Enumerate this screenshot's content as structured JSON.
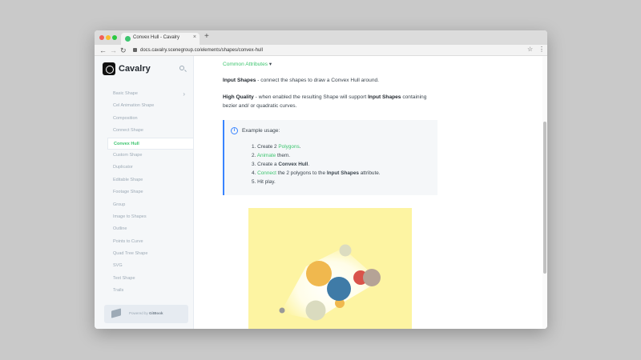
{
  "browser": {
    "tab_title": "Convex Hull - Cavalry",
    "tab_close": "×",
    "new_tab": "+",
    "url": "docs.cavalry.scenegroup.co/elements/shapes/convex-hull",
    "icons": {
      "back": "←",
      "forward": "→",
      "reload": "↻",
      "star": "☆",
      "menu": "⋮"
    }
  },
  "sidebar": {
    "brand": "Cavalry",
    "items": [
      {
        "label": "Basic Shape",
        "chevron": "›"
      },
      {
        "label": "Cel Animation Shape"
      },
      {
        "label": "Composition"
      },
      {
        "label": "Connect Shape"
      },
      {
        "label": "Convex Hull",
        "active": true
      },
      {
        "label": "Custom Shape"
      },
      {
        "label": "Duplicator"
      },
      {
        "label": "Editable Shape"
      },
      {
        "label": "Footage Shape"
      },
      {
        "label": "Group"
      },
      {
        "label": "Image to Shapes"
      },
      {
        "label": "Outline"
      },
      {
        "label": "Points to Curve"
      },
      {
        "label": "Quad Tree Shape"
      },
      {
        "label": "SVG"
      },
      {
        "label": "Text Shape"
      },
      {
        "label": "Trails"
      }
    ],
    "powered_prefix": "Powered by",
    "powered_brand": "GitBook"
  },
  "content": {
    "breadcrumb_link": "Common Attributes",
    "breadcrumb_arrow": "▾",
    "input_shapes_term": "Input Shapes",
    "input_shapes_desc": " - connect the shapes to draw a Convex Hull around.",
    "high_quality_term": "High Quality",
    "high_quality_desc_1": " - when enabled the resulting Shape will support ",
    "high_quality_term_2": "Input Shapes",
    "high_quality_desc_2": " containing bezier and/ or quadratic curves.",
    "hint": {
      "icon": "i",
      "title": "Example usage:",
      "step1_pre": "1. Create 2 ",
      "step1_link": "Polygons",
      "step1_post": ".",
      "step2_num": "2. ",
      "step2_link": "Animate",
      "step2_post": " them.",
      "step3_pre": "3. Create a ",
      "step3_bold": "Convex Hull",
      "step3_post": ".",
      "step4_num": "4. ",
      "step4_link": "Connect",
      "step4_mid": " the 2 polygons to the ",
      "step4_bold": "Input Shapes",
      "step4_post": " attribute.",
      "step5": "5. Hit play."
    }
  },
  "colors": {
    "accent": "#3dc56f",
    "hint_border": "#3884ff",
    "demo_background": "#fdf4a2",
    "circle_orange": "#f0b84e",
    "circle_blue": "#3f7ba7",
    "circle_red": "#d9534a",
    "circle_taupe": "#b5a396",
    "circle_sage": "#dadbbf"
  }
}
